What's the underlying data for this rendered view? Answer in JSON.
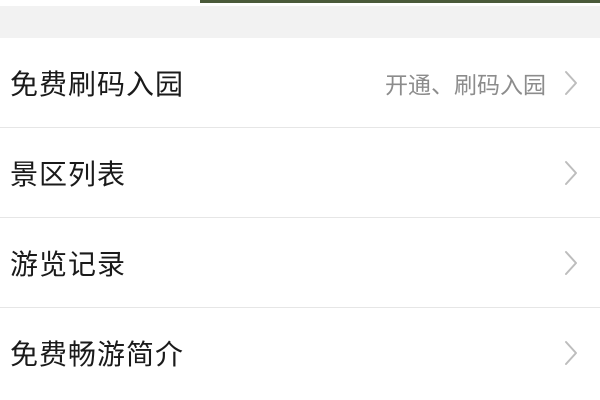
{
  "menu": {
    "items": [
      {
        "label": "免费刷码入园",
        "hint": "开通、刷码入园",
        "icon": "chevron-right-icon"
      },
      {
        "label": "景区列表",
        "hint": "",
        "icon": "chevron-right-icon"
      },
      {
        "label": "游览记录",
        "hint": "",
        "icon": "chevron-right-icon"
      },
      {
        "label": "免费畅游简介",
        "hint": "",
        "icon": "chevron-right-icon"
      }
    ]
  },
  "colors": {
    "background": "#f2f2f2",
    "card": "#ffffff",
    "label_text": "#1a1a1a",
    "hint_text": "#8c8c8c",
    "divider": "#e6e6e6",
    "chevron": "#bdbdbd"
  }
}
